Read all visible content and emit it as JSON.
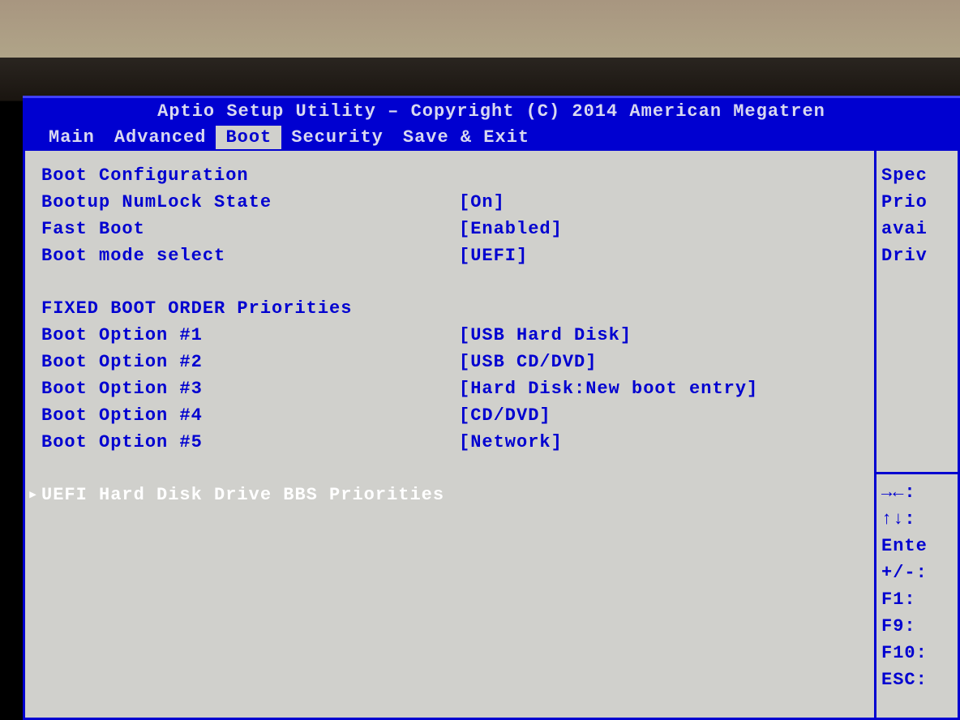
{
  "header": {
    "title": "Aptio Setup Utility – Copyright (C) 2014 American Megatren",
    "tabs": [
      "Main",
      "Advanced",
      "Boot",
      "Security",
      "Save & Exit"
    ],
    "active_tab": "Boot"
  },
  "boot_config": {
    "section_title": "Boot Configuration",
    "items": [
      {
        "label": "Bootup NumLock State",
        "value": "[On]"
      },
      {
        "label": "Fast Boot",
        "value": "[Enabled]"
      },
      {
        "label": "Boot mode select",
        "value": "[UEFI]"
      }
    ]
  },
  "boot_order": {
    "section_title": "FIXED BOOT ORDER Priorities",
    "items": [
      {
        "label": "Boot Option #1",
        "value": "[USB Hard Disk]"
      },
      {
        "label": "Boot Option #2",
        "value": "[USB CD/DVD]"
      },
      {
        "label": "Boot Option #3",
        "value": "[Hard Disk:New boot entry]"
      },
      {
        "label": "Boot Option #4",
        "value": "[CD/DVD]"
      },
      {
        "label": "Boot Option #5",
        "value": "[Network]"
      }
    ]
  },
  "selected": {
    "label": "UEFI Hard Disk Drive BBS Priorities"
  },
  "help": {
    "description_lines": [
      "Spec",
      "Prio",
      "avai",
      "Driv"
    ],
    "keys": [
      "→←:",
      "↑↓:",
      "Ente",
      "+/-:",
      "F1:",
      "F9:",
      "F10:",
      "ESC:"
    ]
  }
}
